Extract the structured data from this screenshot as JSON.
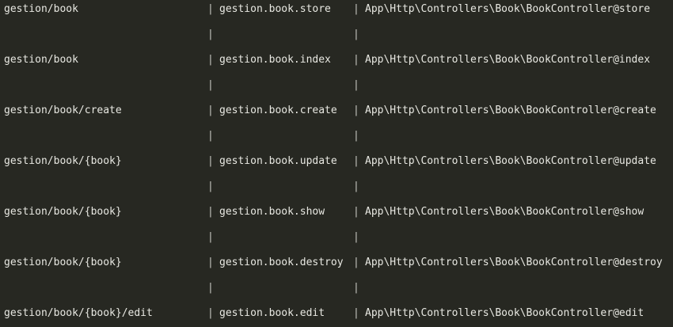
{
  "separator": "|",
  "routes": [
    {
      "uri": "gestion/book",
      "name": "gestion.book.store",
      "action": "App\\Http\\Controllers\\Book\\BookController@store"
    },
    {
      "uri": "gestion/book",
      "name": "gestion.book.index",
      "action": "App\\Http\\Controllers\\Book\\BookController@index"
    },
    {
      "uri": "gestion/book/create",
      "name": "gestion.book.create",
      "action": "App\\Http\\Controllers\\Book\\BookController@create"
    },
    {
      "uri": "gestion/book/{book}",
      "name": "gestion.book.update",
      "action": "App\\Http\\Controllers\\Book\\BookController@update"
    },
    {
      "uri": "gestion/book/{book}",
      "name": "gestion.book.show",
      "action": "App\\Http\\Controllers\\Book\\BookController@show"
    },
    {
      "uri": "gestion/book/{book}",
      "name": "gestion.book.destroy",
      "action": "App\\Http\\Controllers\\Book\\BookController@destroy"
    },
    {
      "uri": "gestion/book/{book}/edit",
      "name": "gestion.book.edit",
      "action": "App\\Http\\Controllers\\Book\\BookController@edit"
    }
  ]
}
